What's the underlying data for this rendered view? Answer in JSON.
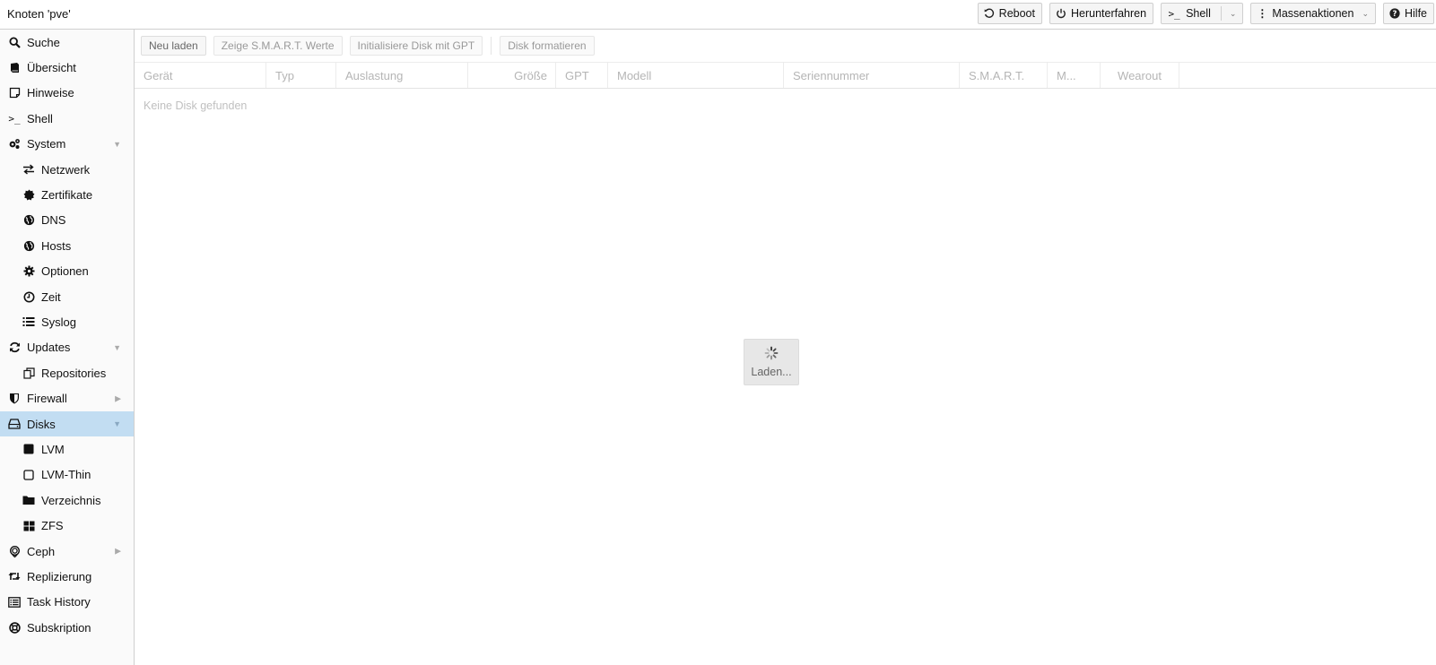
{
  "header": {
    "title": "Knoten 'pve'",
    "buttons": {
      "reboot": "Reboot",
      "shutdown": "Herunterfahren",
      "shell": "Shell",
      "bulk": "Massenaktionen",
      "help": "Hilfe"
    }
  },
  "sidebar": {
    "items": [
      {
        "label": "Suche",
        "icon": "search-icon"
      },
      {
        "label": "Übersicht",
        "icon": "book-icon"
      },
      {
        "label": "Hinweise",
        "icon": "note-icon"
      },
      {
        "label": "Shell",
        "icon": "terminal-icon"
      },
      {
        "label": "System",
        "icon": "cogs-icon"
      },
      {
        "label": "Netzwerk",
        "icon": "exchange-icon"
      },
      {
        "label": "Zertifikate",
        "icon": "certificate-icon"
      },
      {
        "label": "DNS",
        "icon": "globe-icon"
      },
      {
        "label": "Hosts",
        "icon": "globe-icon"
      },
      {
        "label": "Optionen",
        "icon": "gear-icon"
      },
      {
        "label": "Zeit",
        "icon": "clock-icon"
      },
      {
        "label": "Syslog",
        "icon": "list-icon"
      },
      {
        "label": "Updates",
        "icon": "refresh-icon"
      },
      {
        "label": "Repositories",
        "icon": "copy-icon"
      },
      {
        "label": "Firewall",
        "icon": "shield-icon"
      },
      {
        "label": "Disks",
        "icon": "hdd-icon"
      },
      {
        "label": "LVM",
        "icon": "square-icon"
      },
      {
        "label": "LVM-Thin",
        "icon": "square-outline-icon"
      },
      {
        "label": "Verzeichnis",
        "icon": "folder-icon"
      },
      {
        "label": "ZFS",
        "icon": "th-large-icon"
      },
      {
        "label": "Ceph",
        "icon": "ceph-icon"
      },
      {
        "label": "Replizierung",
        "icon": "retweet-icon"
      },
      {
        "label": "Task History",
        "icon": "list-alt-icon"
      },
      {
        "label": "Subskription",
        "icon": "support-icon"
      }
    ]
  },
  "toolbar": {
    "reload": "Neu laden",
    "smart": "Zeige S.M.A.R.T. Werte",
    "init_gpt": "Initialisiere Disk mit GPT",
    "wipe": "Disk formatieren"
  },
  "grid": {
    "columns": [
      "Gerät",
      "Typ",
      "Auslastung",
      "Größe",
      "GPT",
      "Modell",
      "Seriennummer",
      "S.M.A.R.T.",
      "M...",
      "Wearout"
    ],
    "empty_text": "Keine Disk gefunden"
  },
  "loading_text": "Laden..."
}
